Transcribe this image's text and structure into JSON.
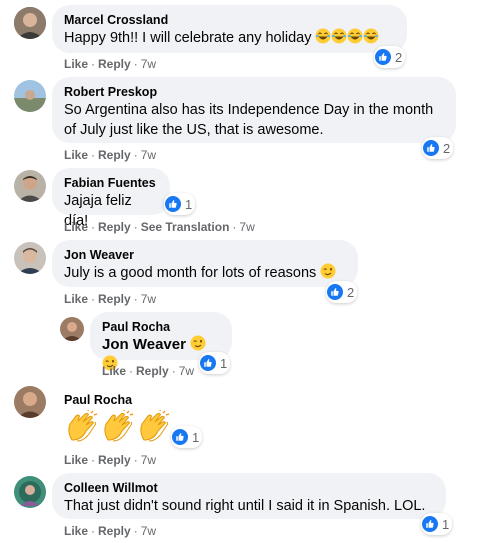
{
  "actions": {
    "like": "Like",
    "reply": "Reply",
    "see_translation": "See Translation",
    "sep": "·"
  },
  "comments": [
    {
      "author": "Marcel Crossland",
      "text": "Happy 9th!! I will celebrate any holiday",
      "emojis": [
        "joy-emoji",
        "joy-emoji",
        "joy-emoji",
        "joy-emoji"
      ],
      "time": "7w",
      "likes": "2"
    },
    {
      "author": "Robert Preskop",
      "text_line1": "So Argentina also has its Independence Day in the month",
      "text_line2": "of July just like the US, that is awesome.",
      "time": "7w",
      "likes": "2"
    },
    {
      "author": "Fabian Fuentes",
      "text": "Jajaja feliz día!",
      "time": "7w",
      "likes": "1"
    },
    {
      "author": "Jon Weaver",
      "text": "July is a good month for lots of reasons",
      "emojis": [
        "wink-emoji"
      ],
      "time": "7w",
      "likes": "2"
    },
    {
      "author": "Paul Rocha",
      "mention": "Jon Weaver",
      "emojis": [
        "wink-emoji",
        "wink-emoji"
      ],
      "time": "7w",
      "likes": "1"
    },
    {
      "author": "Paul Rocha",
      "emojis": [
        "clapping-hands-emoji",
        "clapping-hands-emoji",
        "clapping-hands-emoji"
      ],
      "time": "7w",
      "likes": "1"
    },
    {
      "author": "Colleen Willmot",
      "text": "That just didn't sound right until I said it in Spanish. LOL.",
      "time": "7w",
      "likes": "1"
    }
  ],
  "colors": {
    "bubble": "#f0f2f5",
    "like_blue": "#1877f2",
    "meta_gray": "#65676b"
  }
}
